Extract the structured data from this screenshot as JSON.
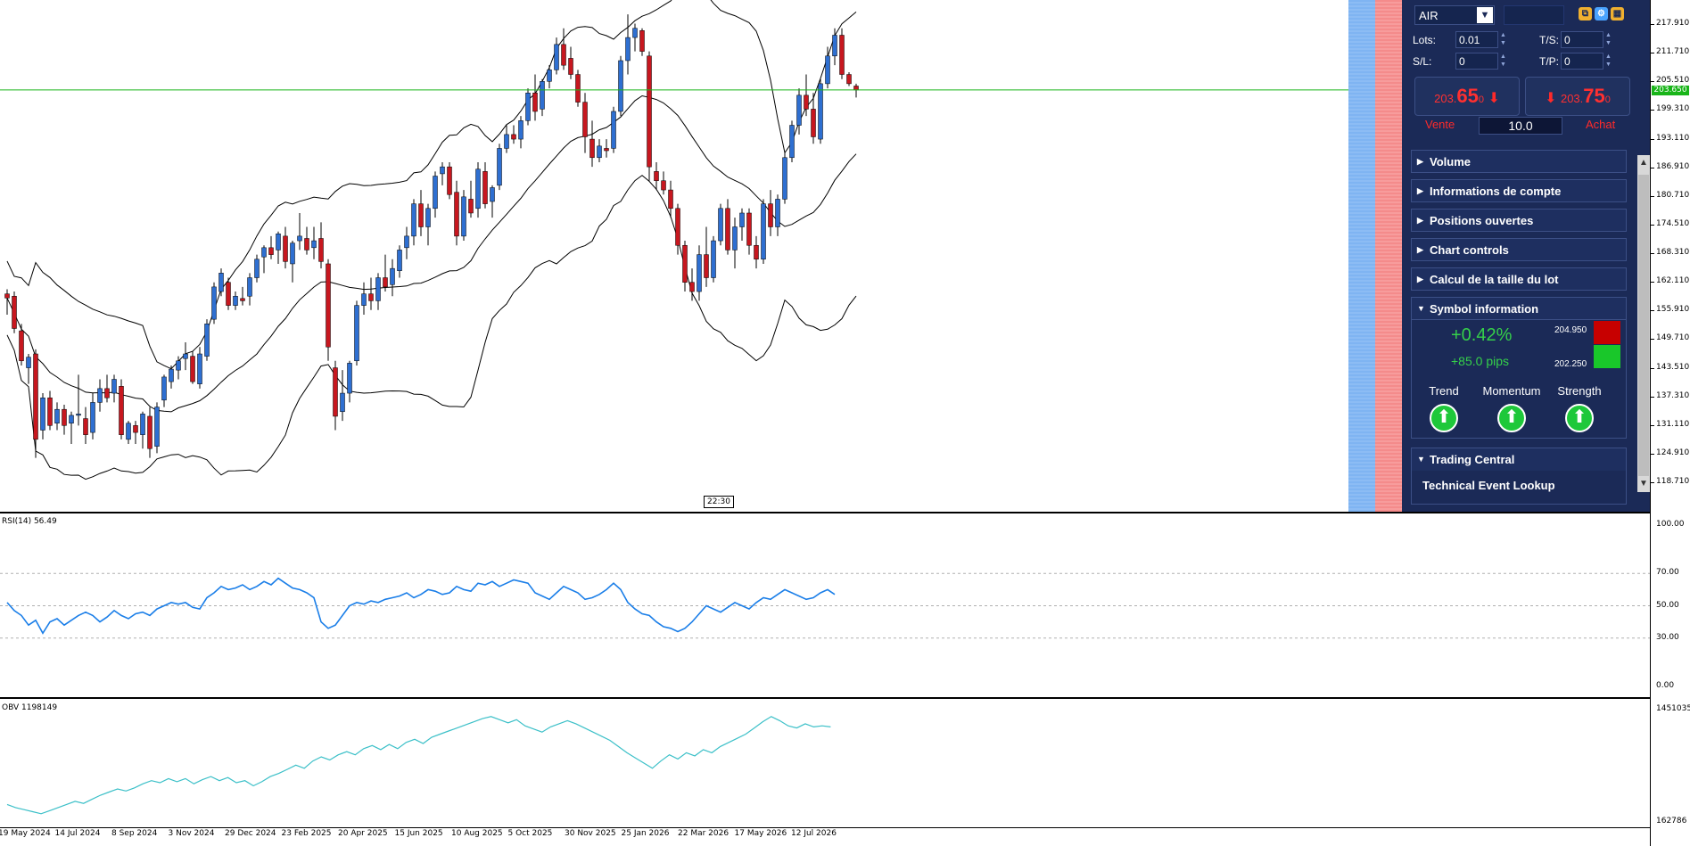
{
  "chart": {
    "current_price_tag": "203.650",
    "time_marker": "22:30",
    "price_axis": [
      "217.910",
      "211.710",
      "205.510",
      "199.310",
      "193.110",
      "186.910",
      "180.710",
      "174.510",
      "168.310",
      "162.110",
      "155.910",
      "149.710",
      "143.510",
      "137.310",
      "131.110",
      "124.910",
      "118.710"
    ],
    "time_axis": [
      "19 May 2024",
      "14 Jul 2024",
      "8 Sep 2024",
      "3 Nov 2024",
      "29 Dec 2024",
      "23 Feb 2025",
      "20 Apr 2025",
      "15 Jun 2025",
      "10 Aug 2025",
      "5 Oct 2025",
      "30 Nov 2025",
      "25 Jan 2026",
      "22 Mar 2026",
      "17 May 2026",
      "12 Jul 2026"
    ]
  },
  "rsi": {
    "label": "RSI(14) 56.49",
    "axis": [
      "100.00",
      "70.00",
      "50.00",
      "30.00",
      "0.00"
    ]
  },
  "obv": {
    "label": "OBV 1198149",
    "axis": [
      "1451035",
      "162786"
    ]
  },
  "colors": {
    "bull": "#2e6fd1",
    "bear": "#c7171f",
    "rsi_line": "#1a7ee8",
    "obv_line": "#3cc0c8",
    "price_line": "#19b519",
    "panel_bg": "#1b2a57"
  },
  "panel": {
    "symbol": "AIR",
    "lots_label": "Lots:",
    "lots_value": "0.01",
    "ts_label": "T/S:",
    "ts_value": "0",
    "sl_label": "S/L:",
    "sl_value": "0",
    "tp_label": "T/P:",
    "tp_value": "0",
    "sell": {
      "prefix": "203.",
      "big": "65",
      "sup": "0",
      "caption": "Vente"
    },
    "buy": {
      "prefix": "203.",
      "big": "75",
      "sup": "0",
      "caption": "Achat"
    },
    "quantity": "10.0",
    "sections": [
      "Volume",
      "Informations de compte",
      "Positions ouvertes",
      "Chart controls",
      "Calcul de la taille du lot"
    ],
    "symbol_info": {
      "title": "Symbol information",
      "change_pct": "+0.42%",
      "change_pips": "+85.0 pips",
      "high": "204.950",
      "low": "202.250",
      "indicators": [
        "Trend",
        "Momentum",
        "Strength"
      ]
    },
    "trading_central": {
      "title": "Trading Central",
      "item": "Technical Event Lookup"
    }
  },
  "chart_data": {
    "type": "candlestick",
    "candles": [
      {
        "o": 159.5,
        "h": 160.5,
        "l": 155,
        "c": 158.6
      },
      {
        "o": 159.0,
        "h": 160,
        "l": 151,
        "c": 152.0
      },
      {
        "o": 151.5,
        "h": 153,
        "l": 144,
        "c": 145.0
      },
      {
        "o": 143.5,
        "h": 146.5,
        "l": 140,
        "c": 145.8
      },
      {
        "o": 146.5,
        "h": 147.5,
        "l": 124,
        "c": 128.0
      },
      {
        "o": 130.0,
        "h": 138,
        "l": 128,
        "c": 137.0
      },
      {
        "o": 137.0,
        "h": 138.5,
        "l": 130,
        "c": 131.0
      },
      {
        "o": 131.5,
        "h": 136,
        "l": 130,
        "c": 134.5
      },
      {
        "o": 134.5,
        "h": 135.5,
        "l": 129,
        "c": 131.0
      },
      {
        "o": 131.5,
        "h": 134,
        "l": 127,
        "c": 133.2
      },
      {
        "o": 133.2,
        "h": 142,
        "l": 131,
        "c": 133.5
      },
      {
        "o": 132.5,
        "h": 135,
        "l": 127,
        "c": 129.0
      },
      {
        "o": 129.5,
        "h": 138,
        "l": 128,
        "c": 136.0
      },
      {
        "o": 136.0,
        "h": 141,
        "l": 134,
        "c": 139.0
      },
      {
        "o": 139.0,
        "h": 142,
        "l": 136,
        "c": 137.0
      },
      {
        "o": 138.0,
        "h": 142,
        "l": 136,
        "c": 141.0
      },
      {
        "o": 139.5,
        "h": 141,
        "l": 128,
        "c": 129.0
      },
      {
        "o": 128.0,
        "h": 132,
        "l": 127,
        "c": 131.5
      },
      {
        "o": 131.0,
        "h": 132,
        "l": 127,
        "c": 129.5
      },
      {
        "o": 129.0,
        "h": 134,
        "l": 126,
        "c": 133.5
      },
      {
        "o": 133.0,
        "h": 135,
        "l": 124,
        "c": 126.0
      },
      {
        "o": 126.5,
        "h": 136,
        "l": 125,
        "c": 135.0
      },
      {
        "o": 136.5,
        "h": 142,
        "l": 135,
        "c": 141.5
      },
      {
        "o": 140.5,
        "h": 144,
        "l": 139,
        "c": 143.2
      },
      {
        "o": 143.0,
        "h": 146,
        "l": 141,
        "c": 145.0
      },
      {
        "o": 145.5,
        "h": 149,
        "l": 143,
        "c": 146.5
      },
      {
        "o": 146.0,
        "h": 147,
        "l": 140,
        "c": 140.5
      },
      {
        "o": 140.0,
        "h": 148,
        "l": 139,
        "c": 146.5
      },
      {
        "o": 146.0,
        "h": 154,
        "l": 145,
        "c": 153.0
      },
      {
        "o": 154.0,
        "h": 162,
        "l": 153,
        "c": 161.0
      },
      {
        "o": 160.0,
        "h": 165,
        "l": 159,
        "c": 164.0
      },
      {
        "o": 162.0,
        "h": 163,
        "l": 156,
        "c": 157.0
      },
      {
        "o": 157.0,
        "h": 160,
        "l": 156,
        "c": 159.0
      },
      {
        "o": 158.5,
        "h": 161,
        "l": 157,
        "c": 158.0
      },
      {
        "o": 159.0,
        "h": 164,
        "l": 157,
        "c": 163.0
      },
      {
        "o": 163.0,
        "h": 168,
        "l": 162,
        "c": 167.0
      },
      {
        "o": 167.5,
        "h": 170,
        "l": 164,
        "c": 169.5
      },
      {
        "o": 169.5,
        "h": 172,
        "l": 167,
        "c": 168.0
      },
      {
        "o": 169.0,
        "h": 173,
        "l": 166,
        "c": 172.5
      },
      {
        "o": 172.0,
        "h": 174,
        "l": 165,
        "c": 166.5
      },
      {
        "o": 166.0,
        "h": 171,
        "l": 162,
        "c": 170.5
      },
      {
        "o": 171.0,
        "h": 177,
        "l": 169,
        "c": 172.0
      },
      {
        "o": 171.5,
        "h": 174,
        "l": 168,
        "c": 169.0
      },
      {
        "o": 169.5,
        "h": 174,
        "l": 167,
        "c": 171.0
      },
      {
        "o": 171.5,
        "h": 175,
        "l": 165,
        "c": 166.5
      },
      {
        "o": 166.0,
        "h": 167,
        "l": 145,
        "c": 148.0
      },
      {
        "o": 143.5,
        "h": 145,
        "l": 130,
        "c": 133.0
      },
      {
        "o": 134.0,
        "h": 143,
        "l": 132,
        "c": 138.0
      },
      {
        "o": 138.0,
        "h": 145,
        "l": 136,
        "c": 144.5
      },
      {
        "o": 145.0,
        "h": 158,
        "l": 144,
        "c": 157.0
      },
      {
        "o": 157.0,
        "h": 162,
        "l": 155,
        "c": 159.5
      },
      {
        "o": 159.5,
        "h": 163,
        "l": 156,
        "c": 158.0
      },
      {
        "o": 158.0,
        "h": 164,
        "l": 156,
        "c": 163.0
      },
      {
        "o": 163.0,
        "h": 168,
        "l": 160,
        "c": 161.0
      },
      {
        "o": 161.5,
        "h": 167,
        "l": 159,
        "c": 165.0
      },
      {
        "o": 164.5,
        "h": 170,
        "l": 163,
        "c": 169.0
      },
      {
        "o": 169.5,
        "h": 174,
        "l": 167,
        "c": 172.0
      },
      {
        "o": 172.0,
        "h": 180,
        "l": 170,
        "c": 179.0
      },
      {
        "o": 179.0,
        "h": 182,
        "l": 172,
        "c": 174.0
      },
      {
        "o": 174.0,
        "h": 179,
        "l": 170,
        "c": 178.0
      },
      {
        "o": 178.0,
        "h": 186,
        "l": 176,
        "c": 185.0
      },
      {
        "o": 185.5,
        "h": 188,
        "l": 183,
        "c": 187.0
      },
      {
        "o": 187.0,
        "h": 188,
        "l": 180,
        "c": 181.0
      },
      {
        "o": 181.5,
        "h": 184,
        "l": 170,
        "c": 172.0
      },
      {
        "o": 172.0,
        "h": 182,
        "l": 171,
        "c": 180.5
      },
      {
        "o": 180.0,
        "h": 184,
        "l": 176,
        "c": 177.0
      },
      {
        "o": 178.0,
        "h": 188,
        "l": 176,
        "c": 186.5
      },
      {
        "o": 186.0,
        "h": 188,
        "l": 178,
        "c": 179.0
      },
      {
        "o": 179.5,
        "h": 183,
        "l": 176,
        "c": 182.5
      },
      {
        "o": 183.0,
        "h": 192,
        "l": 182,
        "c": 191.0
      },
      {
        "o": 191.0,
        "h": 196,
        "l": 190,
        "c": 194.0
      },
      {
        "o": 194.0,
        "h": 196,
        "l": 192,
        "c": 193.0
      },
      {
        "o": 193.0,
        "h": 198,
        "l": 191,
        "c": 197.0
      },
      {
        "o": 197.0,
        "h": 204,
        "l": 196,
        "c": 203.0
      },
      {
        "o": 203.0,
        "h": 207,
        "l": 197,
        "c": 199.0
      },
      {
        "o": 199.5,
        "h": 206,
        "l": 198,
        "c": 205.5
      },
      {
        "o": 205.5,
        "h": 209,
        "l": 204,
        "c": 208.0
      },
      {
        "o": 208.0,
        "h": 215,
        "l": 207,
        "c": 213.5
      },
      {
        "o": 213.5,
        "h": 217,
        "l": 208,
        "c": 209.0
      },
      {
        "o": 210.5,
        "h": 213,
        "l": 206,
        "c": 207.0
      },
      {
        "o": 207.0,
        "h": 208,
        "l": 200,
        "c": 201.0
      },
      {
        "o": 201.0,
        "h": 203,
        "l": 190,
        "c": 193.5
      },
      {
        "o": 193.0,
        "h": 197,
        "l": 187,
        "c": 189.0
      },
      {
        "o": 189.0,
        "h": 193,
        "l": 188,
        "c": 191.5
      },
      {
        "o": 191.0,
        "h": 193,
        "l": 189,
        "c": 190.5
      },
      {
        "o": 191.0,
        "h": 200,
        "l": 190,
        "c": 199.0
      },
      {
        "o": 199.0,
        "h": 211,
        "l": 198,
        "c": 210.0
      },
      {
        "o": 210.0,
        "h": 220,
        "l": 207,
        "c": 215.0
      },
      {
        "o": 215.0,
        "h": 218,
        "l": 212,
        "c": 217.0
      },
      {
        "o": 216.5,
        "h": 217,
        "l": 211,
        "c": 212.0
      },
      {
        "o": 211.0,
        "h": 212,
        "l": 184,
        "c": 187.0
      },
      {
        "o": 186.0,
        "h": 188,
        "l": 182,
        "c": 184.0
      },
      {
        "o": 184.0,
        "h": 186,
        "l": 181,
        "c": 182.0
      },
      {
        "o": 182.0,
        "h": 184,
        "l": 176,
        "c": 178.0
      },
      {
        "o": 178.0,
        "h": 179,
        "l": 168,
        "c": 170.0
      },
      {
        "o": 170.0,
        "h": 171,
        "l": 160,
        "c": 162.0
      },
      {
        "o": 162.0,
        "h": 165,
        "l": 158,
        "c": 160.0
      },
      {
        "o": 160.0,
        "h": 170,
        "l": 158,
        "c": 168.0
      },
      {
        "o": 168.0,
        "h": 174,
        "l": 161,
        "c": 163.0
      },
      {
        "o": 163.0,
        "h": 172,
        "l": 162,
        "c": 171.0
      },
      {
        "o": 171.0,
        "h": 179,
        "l": 170,
        "c": 178.0
      },
      {
        "o": 178.0,
        "h": 180,
        "l": 168,
        "c": 169.0
      },
      {
        "o": 169.0,
        "h": 176,
        "l": 165,
        "c": 174.0
      },
      {
        "o": 174.0,
        "h": 178,
        "l": 171,
        "c": 177.0
      },
      {
        "o": 177.0,
        "h": 178,
        "l": 168,
        "c": 170.0
      },
      {
        "o": 170.0,
        "h": 172,
        "l": 165,
        "c": 167.0
      },
      {
        "o": 167.0,
        "h": 180,
        "l": 166,
        "c": 179.0
      },
      {
        "o": 179.0,
        "h": 182,
        "l": 172,
        "c": 174.0
      },
      {
        "o": 174.0,
        "h": 181,
        "l": 172,
        "c": 180.0
      },
      {
        "o": 180.0,
        "h": 190,
        "l": 179,
        "c": 189.0
      },
      {
        "o": 189.0,
        "h": 197,
        "l": 188,
        "c": 196.0
      },
      {
        "o": 196.0,
        "h": 204,
        "l": 194,
        "c": 202.5
      },
      {
        "o": 202.5,
        "h": 207,
        "l": 198,
        "c": 199.5
      },
      {
        "o": 199.5,
        "h": 203,
        "l": 192,
        "c": 193.5
      },
      {
        "o": 193.0,
        "h": 206,
        "l": 192,
        "c": 205.0
      },
      {
        "o": 205.0,
        "h": 213,
        "l": 204,
        "c": 211.0
      },
      {
        "o": 211.0,
        "h": 217,
        "l": 209,
        "c": 215.5
      },
      {
        "o": 215.5,
        "h": 217,
        "l": 206,
        "c": 207.0
      },
      {
        "o": 207.0,
        "h": 207.5,
        "l": 204.5,
        "c": 205.0
      },
      {
        "o": 204.5,
        "h": 205,
        "l": 202,
        "c": 203.65
      }
    ],
    "rsi": [
      52,
      47,
      44,
      38,
      41,
      33,
      40,
      42,
      38,
      41,
      44,
      46,
      44,
      40,
      43,
      47,
      44,
      42,
      45,
      46,
      44,
      48,
      50,
      52,
      51,
      52,
      49,
      48,
      55,
      58,
      62,
      60,
      61,
      63,
      60,
      62,
      65,
      63,
      67,
      64,
      61,
      60,
      58,
      55,
      40,
      36,
      38,
      44,
      50,
      52,
      51,
      53,
      52,
      54,
      55,
      56,
      58,
      55,
      57,
      60,
      59,
      57,
      58,
      62,
      60,
      59,
      64,
      63,
      65,
      62,
      64,
      66,
      65,
      64,
      58,
      56,
      54,
      58,
      62,
      60,
      58,
      54,
      55,
      57,
      60,
      64,
      60,
      52,
      48,
      45,
      44,
      40,
      37,
      36,
      34,
      36,
      40,
      45,
      50,
      48,
      46,
      49,
      52,
      50,
      48,
      52,
      55,
      54,
      57,
      60,
      58,
      56,
      54,
      55,
      58,
      60,
      57
    ],
    "obv": [
      0.1,
      0.07,
      0.05,
      0.03,
      0.01,
      0.04,
      0.07,
      0.1,
      0.13,
      0.11,
      0.15,
      0.19,
      0.22,
      0.25,
      0.23,
      0.26,
      0.3,
      0.33,
      0.31,
      0.35,
      0.32,
      0.35,
      0.3,
      0.34,
      0.37,
      0.33,
      0.36,
      0.31,
      0.33,
      0.28,
      0.32,
      0.37,
      0.4,
      0.44,
      0.48,
      0.45,
      0.52,
      0.56,
      0.53,
      0.58,
      0.61,
      0.58,
      0.64,
      0.67,
      0.63,
      0.68,
      0.64,
      0.7,
      0.73,
      0.69,
      0.75,
      0.78,
      0.81,
      0.84,
      0.87,
      0.9,
      0.93,
      0.95,
      0.92,
      0.89,
      0.92,
      0.86,
      0.83,
      0.8,
      0.85,
      0.88,
      0.91,
      0.88,
      0.84,
      0.8,
      0.76,
      0.72,
      0.66,
      0.6,
      0.55,
      0.5,
      0.45,
      0.52,
      0.58,
      0.54,
      0.6,
      0.57,
      0.63,
      0.6,
      0.66,
      0.7,
      0.74,
      0.78,
      0.84,
      0.9,
      0.95,
      0.91,
      0.86,
      0.84,
      0.88,
      0.85,
      0.86,
      0.85
    ]
  }
}
